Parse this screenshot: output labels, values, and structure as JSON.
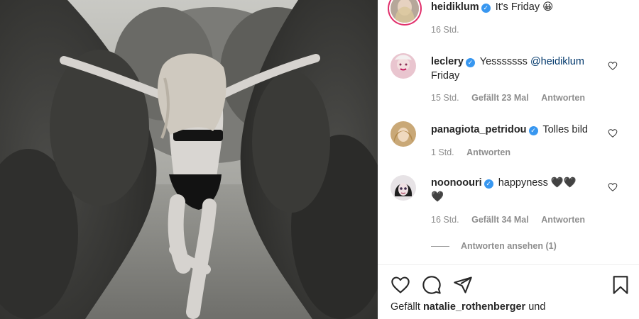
{
  "post": {
    "author": "heidiklum",
    "caption": "It's Friday",
    "caption_emoji": "😀",
    "time": "16 Std."
  },
  "comments": [
    {
      "user": "leclery",
      "text_before": "Yesssssss",
      "mention": "@heidiklum",
      "text_after": "Friday",
      "time": "15 Std.",
      "likes": "Gefällt 23 Mal",
      "reply": "Antworten"
    },
    {
      "user": "panagiota_petridou",
      "text": "Tolles bild",
      "time": "1 Std.",
      "reply": "Antworten"
    },
    {
      "user": "noonoouri",
      "text": "happyness 🖤🖤",
      "text_line2": "🖤",
      "time": "16 Std.",
      "likes": "Gefällt 34 Mal",
      "reply": "Antworten"
    }
  ],
  "view_replies": "Antworten ansehen (1)",
  "likes_line": {
    "prefix": "Gefällt",
    "user": "natalie_rothenberger",
    "suffix": "und"
  },
  "icons": {
    "like": "heart-icon",
    "comment": "comment-icon",
    "share": "share-icon",
    "save": "bookmark-icon",
    "verified": "verified-badge-icon"
  },
  "colors": {
    "verified": "#3897f0",
    "text": "#262626",
    "muted": "#8e8e8e",
    "mention": "#00376b"
  }
}
